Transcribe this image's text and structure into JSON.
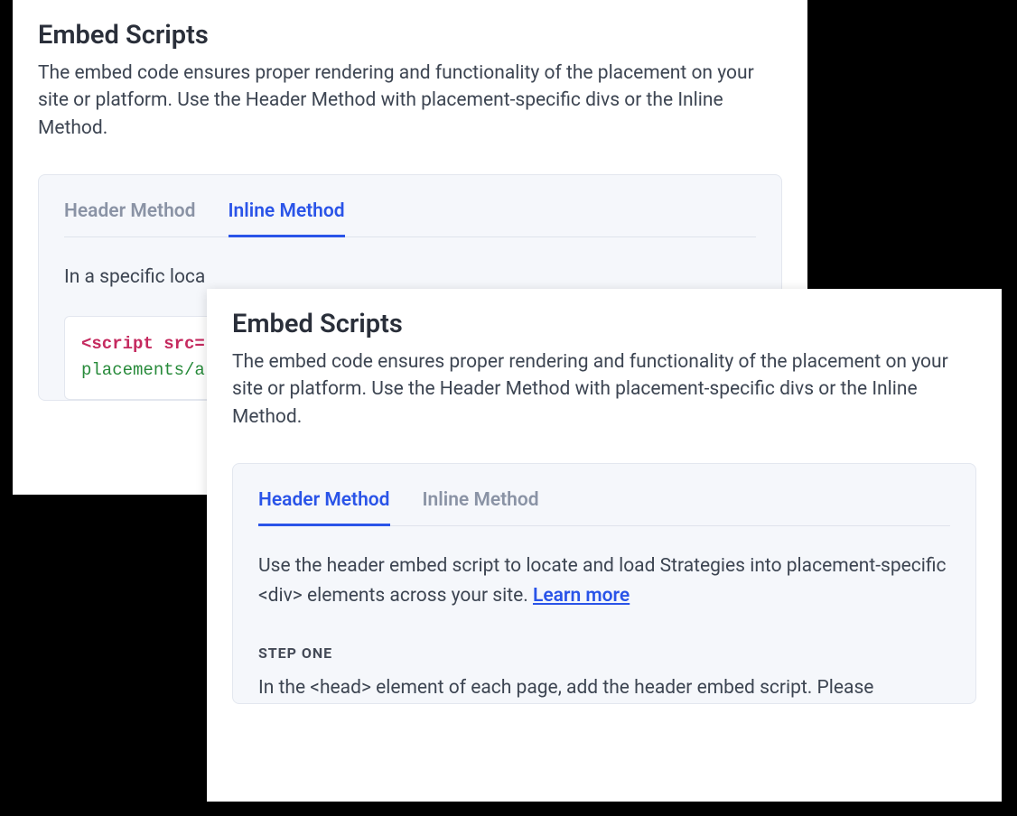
{
  "back": {
    "title": "Embed Scripts",
    "desc": "The embed code ensures proper rendering and functionality of the placement on your site or platform. Use the Header Method with placement-specific divs or the Inline Method.",
    "tabs": {
      "header": "Header Method",
      "inline": "Inline Method",
      "active": "inline"
    },
    "body_text": "In a specific loca",
    "code": {
      "line1_tag": "<script src=",
      "line2_val": "placements/a"
    }
  },
  "front": {
    "title": "Embed Scripts",
    "desc": "The embed code ensures proper rendering and functionality of the placement on your site or platform. Use the Header Method with placement-specific divs or the Inline Method.",
    "tabs": {
      "header": "Header Method",
      "inline": "Inline Method",
      "active": "header"
    },
    "body_text": "Use the header embed script to locate and load Strategies into placement-specific <div> elements across your site. ",
    "learn_more": "Learn more",
    "step": {
      "label": "STEP ONE",
      "text": "In the <head> element of each page, add the header embed script. Please"
    }
  }
}
